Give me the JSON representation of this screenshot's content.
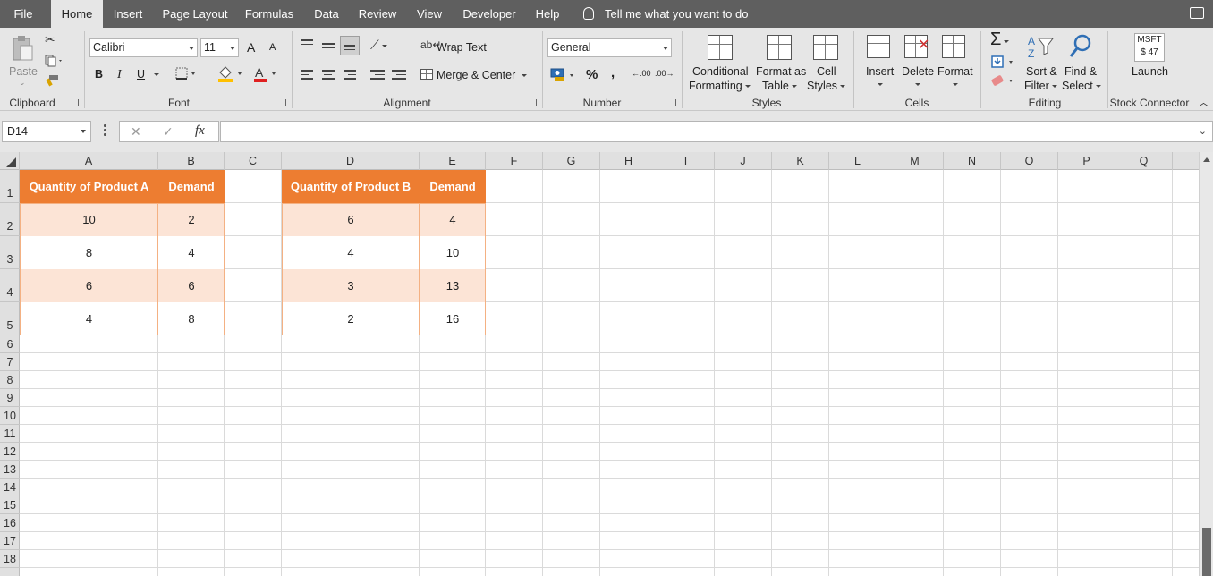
{
  "menu": {
    "tabs": [
      "File",
      "Home",
      "Insert",
      "Page Layout",
      "Formulas",
      "Data",
      "Review",
      "View",
      "Developer",
      "Help"
    ],
    "active_tab": "Home",
    "tell_me": "Tell me what you want to do"
  },
  "ribbon": {
    "clipboard": {
      "label": "Clipboard",
      "paste": "Paste"
    },
    "font": {
      "label": "Font",
      "name": "Calibri",
      "size": "11",
      "bold": "B",
      "italic": "I",
      "underline": "U",
      "grow": "A",
      "shrink": "A"
    },
    "alignment": {
      "label": "Alignment",
      "wrap_text": "Wrap Text",
      "merge_center": "Merge & Center"
    },
    "number": {
      "label": "Number",
      "format": "General",
      "percent": "%",
      "comma": ",",
      "inc_decimal": ".00",
      "dec_decimal": ".00"
    },
    "styles": {
      "label": "Styles",
      "conditional_1": "Conditional",
      "conditional_2": "Formatting",
      "format_table_1": "Format as",
      "format_table_2": "Table",
      "cell_styles_1": "Cell",
      "cell_styles_2": "Styles"
    },
    "cells": {
      "label": "Cells",
      "insert": "Insert",
      "delete": "Delete",
      "format": "Format"
    },
    "editing": {
      "label": "Editing",
      "sum": "Σ",
      "sort_1": "Sort &",
      "sort_2": "Filter",
      "find_1": "Find &",
      "find_2": "Select"
    },
    "stock": {
      "label": "Stock Connector",
      "ticker": "MSFT",
      "price": "$ 47",
      "launch": "Launch"
    }
  },
  "formula_bar": {
    "name_box": "D14",
    "fx": "fx",
    "value": ""
  },
  "columns": [
    "A",
    "B",
    "C",
    "D",
    "E",
    "F",
    "G",
    "H",
    "I",
    "J",
    "K",
    "L",
    "M",
    "N",
    "O",
    "P",
    "Q"
  ],
  "rows": [
    "1",
    "2",
    "3",
    "4",
    "5",
    "6",
    "7",
    "8",
    "9",
    "10",
    "11",
    "12",
    "13",
    "14",
    "15",
    "16",
    "17",
    "18"
  ],
  "table_a": {
    "headers": [
      "Quantity of Product A",
      "Demand"
    ],
    "rows": [
      [
        "10",
        "2"
      ],
      [
        "8",
        "4"
      ],
      [
        "6",
        "6"
      ],
      [
        "4",
        "8"
      ]
    ]
  },
  "table_b": {
    "headers": [
      "Quantity of Product B",
      "Demand"
    ],
    "rows": [
      [
        "6",
        "4"
      ],
      [
        "4",
        "10"
      ],
      [
        "3",
        "13"
      ],
      [
        "2",
        "16"
      ]
    ]
  },
  "colors": {
    "header_orange": "#ed7d31",
    "band_peach": "#fce4d6",
    "border_peach": "#f4b183",
    "menubar": "#5f5f5f"
  }
}
